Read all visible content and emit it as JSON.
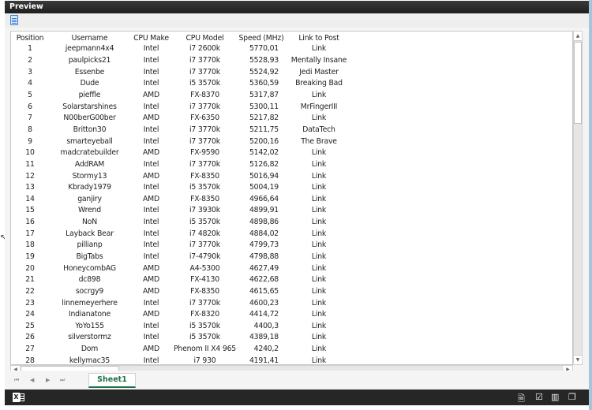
{
  "window": {
    "title": "Preview"
  },
  "toolbar": {
    "icons": [
      "document-icon"
    ]
  },
  "table": {
    "columns": [
      "Position",
      "Username",
      "CPU Make",
      "CPU Model",
      "Speed (MHz)",
      "Link to Post"
    ],
    "rows": [
      [
        "1",
        "jeepmann4x4",
        "Intel",
        "i7 2600k",
        "5770,01",
        "Link"
      ],
      [
        "2",
        "paulpicks21",
        "Intel",
        "i7 3770k",
        "5528,93",
        "Mentally Insane"
      ],
      [
        "3",
        "Essenbe",
        "Intel",
        "i7 3770k",
        "5524,92",
        "Jedi Master"
      ],
      [
        "4",
        "Dude",
        "Intel",
        "i5 3570k",
        "5360,59",
        "Breaking Bad"
      ],
      [
        "5",
        "pieffle",
        "AMD",
        "FX-8370",
        "5317,87",
        "Link"
      ],
      [
        "6",
        "Solarstarshines",
        "Intel",
        "i7 3770k",
        "5300,11",
        "MrFingerIII"
      ],
      [
        "7",
        "N00berG00ber",
        "AMD",
        "FX-6350",
        "5217,82",
        "Link"
      ],
      [
        "8",
        "Britton30",
        "Intel",
        "i7 3770k",
        "5211,75",
        "DataTech"
      ],
      [
        "9",
        "smarteyeball",
        "Intel",
        "i7 3770k",
        "5200,16",
        "The Brave"
      ],
      [
        "10",
        "madcratebuilder",
        "AMD",
        "FX-9590",
        "5142,02",
        "Link"
      ],
      [
        "11",
        "AddRAM",
        "Intel",
        "i7 3770k",
        "5126,82",
        "Link"
      ],
      [
        "12",
        "Stormy13",
        "AMD",
        "FX-8350",
        "5016,94",
        "Link"
      ],
      [
        "13",
        "Kbrady1979",
        "Intel",
        "i5 3570k",
        "5004,19",
        "Link"
      ],
      [
        "14",
        "ganjiry",
        "AMD",
        "FX-8350",
        "4966,64",
        "Link"
      ],
      [
        "15",
        "Wrend",
        "Intel",
        "i7 3930k",
        "4899,91",
        "Link"
      ],
      [
        "16",
        "NoN",
        "Intel",
        "i5 3570k",
        "4898,86",
        "Link"
      ],
      [
        "17",
        "Layback Bear",
        "Intel",
        "i7 4820k",
        "4884,02",
        "Link"
      ],
      [
        "18",
        "pillianp",
        "Intel",
        "i7 3770k",
        "4799,73",
        "Link"
      ],
      [
        "19",
        "BigTabs",
        "Intel",
        "i7-4790k",
        "4798,88",
        "Link"
      ],
      [
        "20",
        "HoneycombAG",
        "AMD",
        "A4-5300",
        "4627,49",
        "Link"
      ],
      [
        "21",
        "dc898",
        "AMD",
        "FX-4130",
        "4622,68",
        "Link"
      ],
      [
        "22",
        "socrgy9",
        "AMD",
        "FX-8350",
        "4615,65",
        "Link"
      ],
      [
        "23",
        "linnemeyerhere",
        "Intel",
        "i7 3770k",
        "4600,23",
        "Link"
      ],
      [
        "24",
        "Indianatone",
        "AMD",
        "FX-8320",
        "4414,72",
        "Link"
      ],
      [
        "25",
        "YoYo155",
        "Intel",
        "i5 3570k",
        "4400,3",
        "Link"
      ],
      [
        "26",
        "silverstormz",
        "Intel",
        "i5 3570k",
        "4389,18",
        "Link"
      ],
      [
        "27",
        "Dom",
        "AMD",
        "Phenom II X4 965",
        "4240,2",
        "Link"
      ],
      [
        "28",
        "kellymac35",
        "Intel",
        "i7 930",
        "4191,41",
        "Link"
      ]
    ]
  },
  "sheet_tabs": {
    "active": "Sheet1"
  },
  "nav": {
    "first": "⏮",
    "prev": "◀",
    "next": "▶",
    "last": "⏭"
  },
  "scroll": {
    "up": "▲",
    "down": "▼",
    "left": "◀",
    "right": "▶"
  },
  "statusbar": {
    "app_icon": "excel-icon",
    "icons": [
      "download-icon",
      "briefcase-check-icon",
      "reading-view-icon",
      "popout-icon"
    ]
  },
  "colors": {
    "accent": "#1e7145",
    "titlebar": "#262626"
  }
}
